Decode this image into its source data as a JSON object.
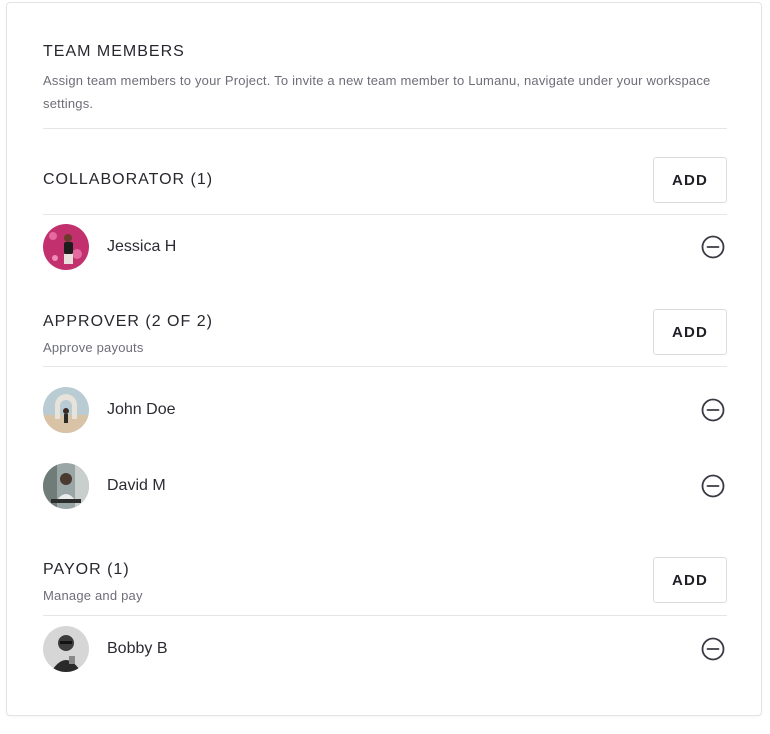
{
  "header": {
    "title": "TEAM MEMBERS",
    "description": "Assign team members to your Project. To invite a new team member to Lumanu, navigate under your workspace settings."
  },
  "sections": [
    {
      "title": "COLLABORATOR (1)",
      "subtitle": "",
      "add_label": "ADD",
      "members": [
        {
          "name": "Jessica  H",
          "avatar": "photo-pink-background",
          "remove_icon": "minus-circle-icon"
        }
      ]
    },
    {
      "title": "APPROVER (2 OF 2)",
      "subtitle": "Approve payouts",
      "add_label": "ADD",
      "members": [
        {
          "name": "John Doe",
          "avatar": "photo-beach-arch",
          "remove_icon": "minus-circle-icon"
        },
        {
          "name": "David M",
          "avatar": "photo-office-laptop",
          "remove_icon": "minus-circle-icon"
        }
      ]
    },
    {
      "title": "PAYOR (1)",
      "subtitle": "Manage and pay",
      "add_label": "ADD",
      "members": [
        {
          "name": "Bobby B",
          "avatar": "photo-grayscale-portrait",
          "remove_icon": "minus-circle-icon"
        }
      ]
    }
  ],
  "colors": {
    "text": "#27272e",
    "muted": "#6e6e78",
    "border": "#dcdce0",
    "icon": "#3a3a44"
  }
}
